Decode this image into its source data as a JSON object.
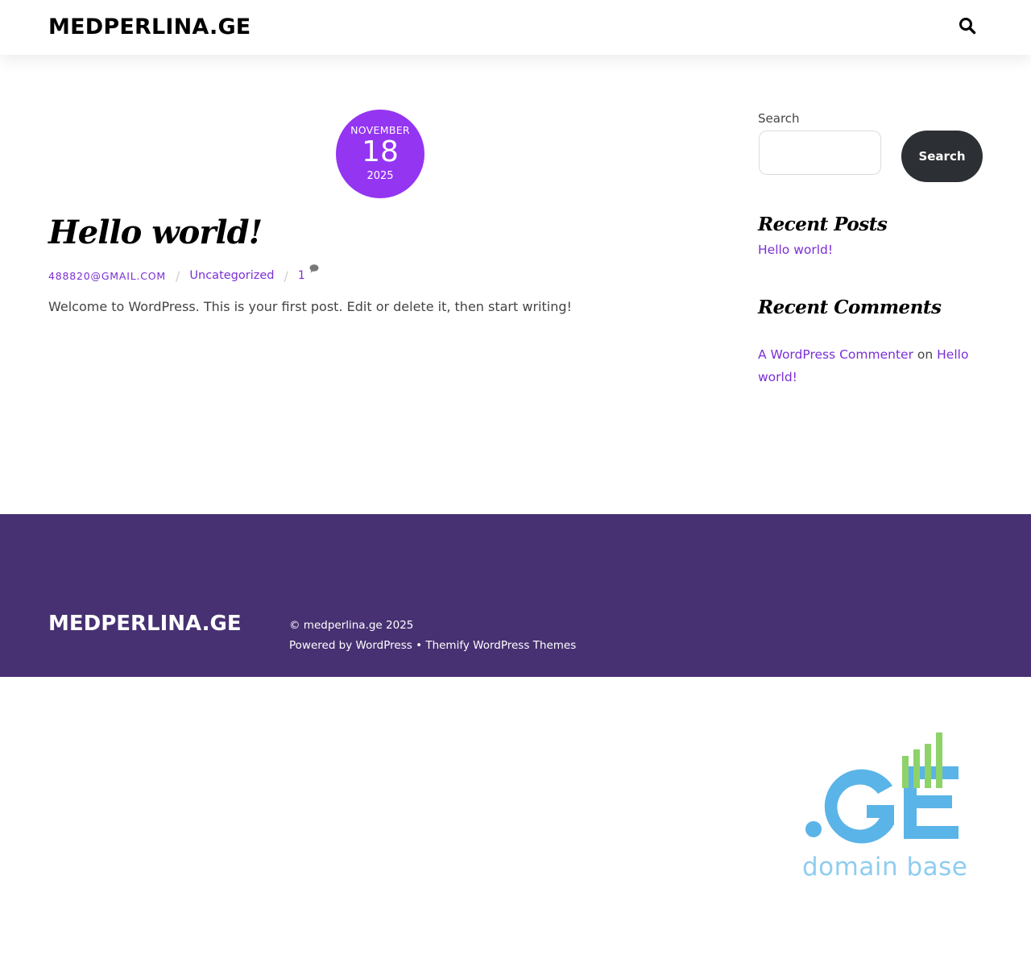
{
  "header": {
    "logo": "MEDPERLINA.GE",
    "search_icon": "search-icon"
  },
  "post": {
    "date": {
      "month": "NOVEMBER",
      "day": "18",
      "year": "2025"
    },
    "title": "Hello world!",
    "author": "488820@GMAIL.COM",
    "category": "Uncategorized",
    "comment_count": "1",
    "excerpt": "Welcome to WordPress. This is your first post. Edit or delete it, then start writing!"
  },
  "sidebar": {
    "search": {
      "label": "Search",
      "placeholder": "",
      "button_label": "Search"
    },
    "recent_posts": {
      "title": "Recent Posts",
      "items": [
        "Hello world!"
      ]
    },
    "recent_comments": {
      "title": "Recent Comments",
      "items": [
        {
          "author": "A WordPress Commenter",
          "connector": "on",
          "post": "Hello world!"
        }
      ]
    }
  },
  "footer": {
    "logo": "MEDPERLINA.GE",
    "copyright": "© medperlina.ge 2025",
    "powered_by": "Powered by WordPress",
    "separator": "•",
    "theme_credit": "Themify WordPress Themes"
  },
  "domain_logo": {
    "mark": ".GE",
    "text": "domain base"
  },
  "colors": {
    "accent": "#9435f2",
    "link": "#7b2fd6",
    "footer_bg": "#473172",
    "button_bg": "#2c2f33",
    "domain_blue": "#5ab4e8",
    "domain_green": "#8dd36a"
  }
}
